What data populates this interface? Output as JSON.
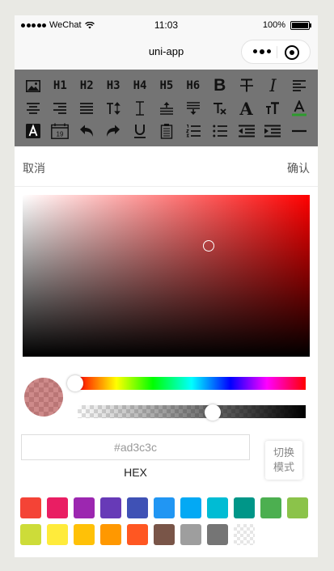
{
  "status_bar": {
    "carrier": "WeChat",
    "time": "11:03",
    "battery": "100%"
  },
  "navbar": {
    "title": "uni-app"
  },
  "toolbar": {
    "row1": [
      "image-icon",
      "H1",
      "H2",
      "H3",
      "H4",
      "H5",
      "H6",
      "bold-icon",
      "strikethrough-icon",
      "italic-icon",
      "align-left-icon"
    ],
    "row2": [
      "align-center-icon",
      "align-right-icon",
      "align-justify-icon",
      "line-height-icon",
      "letter-spacing-icon",
      "space-before-icon",
      "space-after-icon",
      "clear-format-icon",
      "font-icon",
      "font-size-icon",
      "font-color-icon"
    ],
    "row3": [
      "background-color-icon",
      "date-icon",
      "undo-icon",
      "redo-icon",
      "underline-icon",
      "clear-icon",
      "ordered-list-icon",
      "bullet-list-icon",
      "outdent-icon",
      "indent-icon",
      "divider-icon"
    ],
    "date_number": "19",
    "font_color": "#2e9b2e"
  },
  "actions": {
    "cancel": "取消",
    "confirm": "确认"
  },
  "picker": {
    "hue_color": "#ff0000",
    "selected_color": "#ad3c3c",
    "alpha": 0.6,
    "hex_value": "#ad3c3c",
    "mode_label": "HEX",
    "switch_label_line1": "切换",
    "switch_label_line2": "模式"
  },
  "swatches": [
    "#f44336",
    "#e91e63",
    "#9c27b0",
    "#673ab7",
    "#3f51b5",
    "#2196f3",
    "#03a9f4",
    "#00bcd4",
    "#009688",
    "#4caf50",
    "#8bc34a",
    "#cddc39",
    "#ffeb3b",
    "#ffc107",
    "#ff9800",
    "#ff5722",
    "#795548",
    "#9e9e9e",
    "#757575",
    "transparent"
  ]
}
